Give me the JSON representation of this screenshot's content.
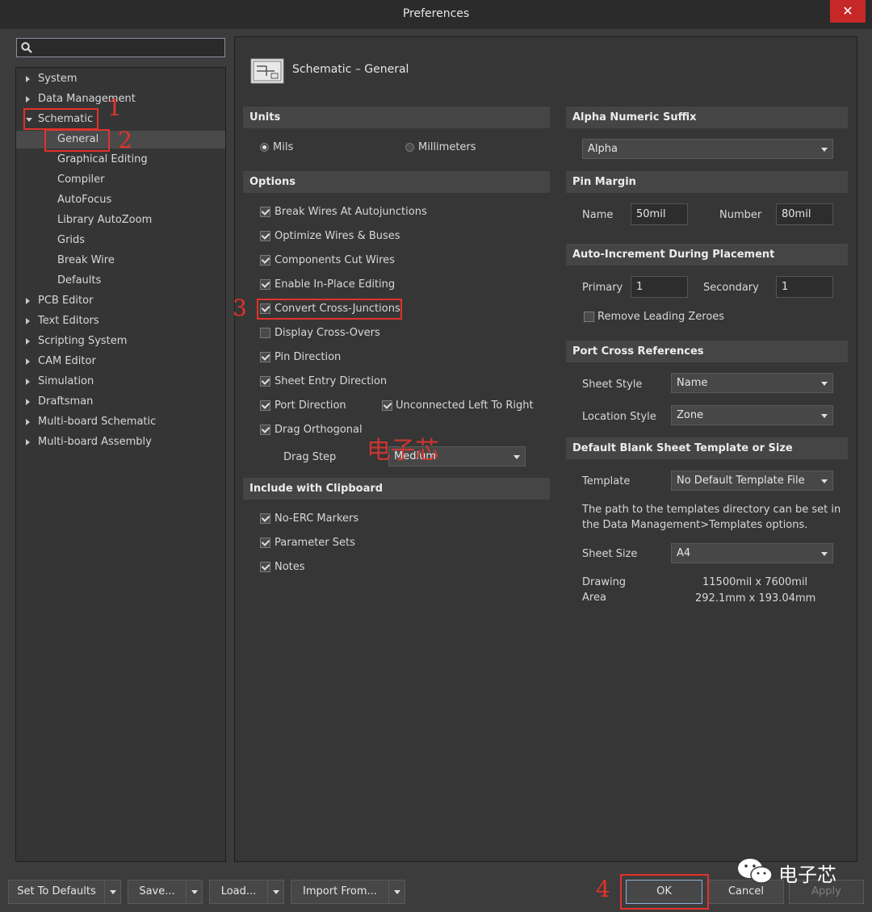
{
  "window": {
    "title": "Preferences",
    "close_glyph": "✕"
  },
  "search": {
    "placeholder": ""
  },
  "tree": {
    "system": "System",
    "data_management": "Data Management",
    "schematic": "Schematic",
    "children": [
      "General",
      "Graphical Editing",
      "Compiler",
      "AutoFocus",
      "Library AutoZoom",
      "Grids",
      "Break Wire",
      "Defaults"
    ],
    "rest": [
      "PCB Editor",
      "Text Editors",
      "Scripting System",
      "CAM Editor",
      "Simulation",
      "Draftsman",
      "Multi-board Schematic",
      "Multi-board Assembly"
    ]
  },
  "page": {
    "title": "Schematic – General"
  },
  "units": {
    "header": "Units",
    "mils": "Mils",
    "millimeters": "Millimeters",
    "selected": "Mils"
  },
  "options": {
    "header": "Options",
    "items": [
      {
        "label": "Break Wires At Autojunctions",
        "checked": true
      },
      {
        "label": "Optimize Wires & Buses",
        "checked": true
      },
      {
        "label": "Components Cut Wires",
        "checked": true
      },
      {
        "label": "Enable In-Place Editing",
        "checked": true
      },
      {
        "label": "Convert Cross-Junctions",
        "checked": true
      },
      {
        "label": "Display Cross-Overs",
        "checked": false
      },
      {
        "label": "Pin Direction",
        "checked": true
      },
      {
        "label": "Sheet Entry Direction",
        "checked": true
      },
      {
        "label": "Port Direction",
        "checked": true
      },
      {
        "label": "Drag Orthogonal",
        "checked": true
      }
    ],
    "unconnected_label": "Unconnected Left To Right",
    "unconnected_checked": true,
    "drag_step_label": "Drag Step",
    "drag_step_value": "Medium"
  },
  "clipboard": {
    "header": "Include with Clipboard",
    "items": [
      {
        "label": "No-ERC Markers",
        "checked": true
      },
      {
        "label": "Parameter Sets",
        "checked": true
      },
      {
        "label": "Notes",
        "checked": true
      }
    ]
  },
  "alpha": {
    "header": "Alpha Numeric Suffix",
    "value": "Alpha"
  },
  "pin_margin": {
    "header": "Pin Margin",
    "name_label": "Name",
    "name_value": "50mil",
    "number_label": "Number",
    "number_value": "80mil"
  },
  "auto_inc": {
    "header": "Auto-Increment During Placement",
    "primary_label": "Primary",
    "primary_value": "1",
    "secondary_label": "Secondary",
    "secondary_value": "1",
    "remove_zeroes": "Remove Leading Zeroes",
    "remove_zeroes_checked": false
  },
  "port_xref": {
    "header": "Port Cross References",
    "sheet_style_label": "Sheet Style",
    "sheet_style_value": "Name",
    "location_style_label": "Location Style",
    "location_style_value": "Zone"
  },
  "template": {
    "header": "Default Blank Sheet Template or Size",
    "template_label": "Template",
    "template_value": "No Default Template File",
    "note_line1": "The path to the templates directory can be set in",
    "note_line2": "the Data Management>Templates options.",
    "sheet_size_label": "Sheet Size",
    "sheet_size_value": "A4",
    "drawing_label1": "Drawing",
    "drawing_label2": "Area",
    "drawing_mil": "11500mil x 7600mil",
    "drawing_mm": "292.1mm x 193.04mm"
  },
  "footer": {
    "set_defaults": "Set To Defaults",
    "save": "Save...",
    "load": "Load...",
    "import_from": "Import From...",
    "ok": "OK",
    "cancel": "Cancel",
    "apply": "Apply"
  },
  "annotations": {
    "n1": "1",
    "n2": "2",
    "n3": "3",
    "n4": "4",
    "watermark_mid": "电子芯",
    "watermark_corner": "电子芯"
  },
  "colors": {
    "annotation_red": "#e3322b",
    "close_red": "#c62828"
  }
}
